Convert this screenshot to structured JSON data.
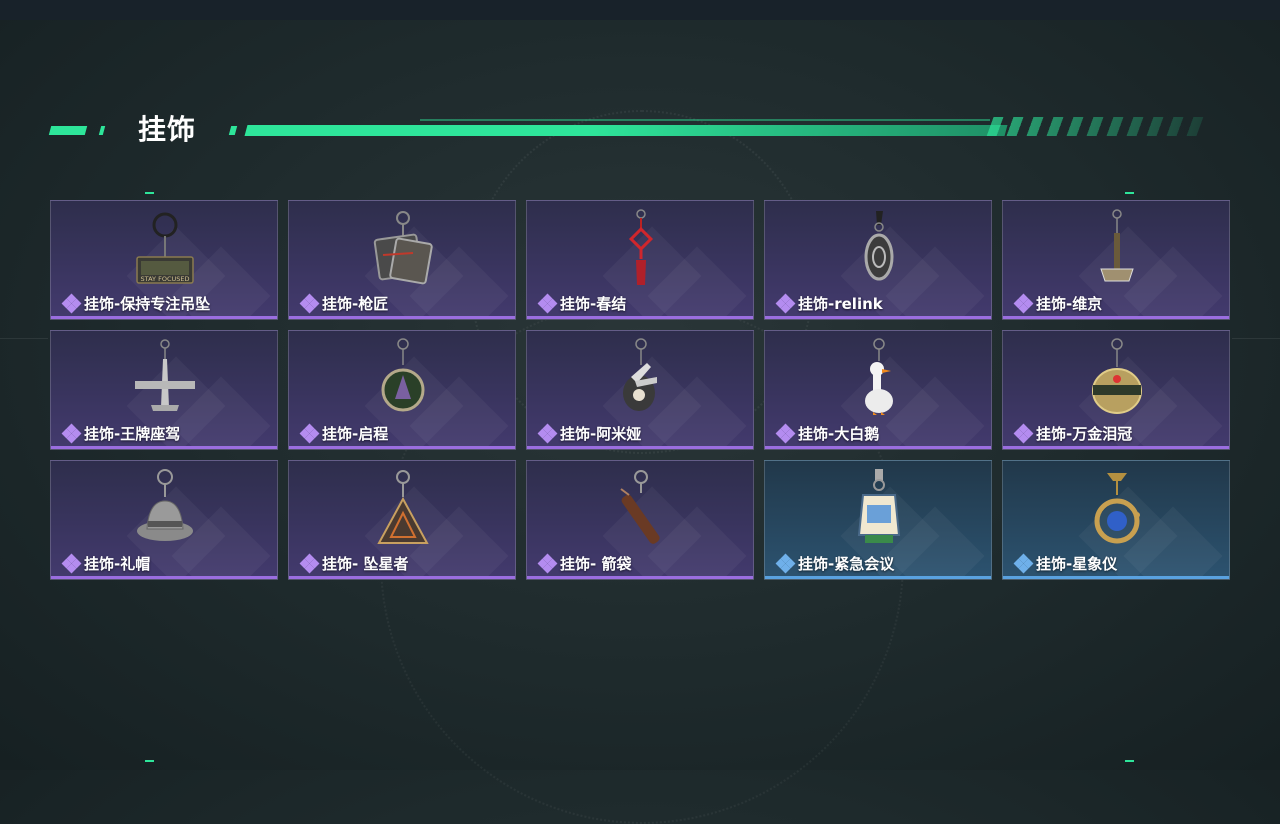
{
  "header": {
    "title": "挂饰"
  },
  "colors": {
    "accent": "#2ee59a",
    "purple_rarity": "#9b6ee0",
    "blue_rarity": "#5aa2e0"
  },
  "items": [
    {
      "name": "挂饰-保持专注吊坠",
      "rarity": "purple",
      "icon": "stay-focused-tag-charm-icon",
      "tag_text": "STAY FOCUSED"
    },
    {
      "name": "挂饰-枪匠",
      "rarity": "purple",
      "icon": "gunsmith-tag-charm-icon"
    },
    {
      "name": "挂饰-春结",
      "rarity": "purple",
      "icon": "chinese-knot-charm-icon"
    },
    {
      "name": "挂饰-relink",
      "rarity": "purple",
      "icon": "relink-turtle-charm-icon"
    },
    {
      "name": "挂饰-维京",
      "rarity": "purple",
      "icon": "viking-hammer-charm-icon"
    },
    {
      "name": "挂饰-王牌座驾",
      "rarity": "purple",
      "icon": "ace-jet-charm-icon"
    },
    {
      "name": "挂饰-启程",
      "rarity": "purple",
      "icon": "departure-medal-charm-icon"
    },
    {
      "name": "挂饰-阿米娅",
      "rarity": "purple",
      "icon": "amiya-charm-icon"
    },
    {
      "name": "挂饰-大白鹅",
      "rarity": "purple",
      "icon": "white-goose-charm-icon"
    },
    {
      "name": "挂饰-万金泪冠",
      "rarity": "purple",
      "icon": "golden-crown-charm-icon"
    },
    {
      "name": "挂饰-礼帽",
      "rarity": "purple",
      "icon": "top-hat-charm-icon"
    },
    {
      "name": "挂饰- 坠星者",
      "rarity": "purple",
      "icon": "star-faller-triangle-charm-icon"
    },
    {
      "name": "挂饰- 箭袋",
      "rarity": "purple",
      "icon": "quiver-charm-icon"
    },
    {
      "name": "挂饰-紧急会议",
      "rarity": "blue",
      "icon": "emergency-meeting-charm-icon"
    },
    {
      "name": "挂饰-星象仪",
      "rarity": "blue",
      "icon": "astrolabe-charm-icon"
    }
  ]
}
